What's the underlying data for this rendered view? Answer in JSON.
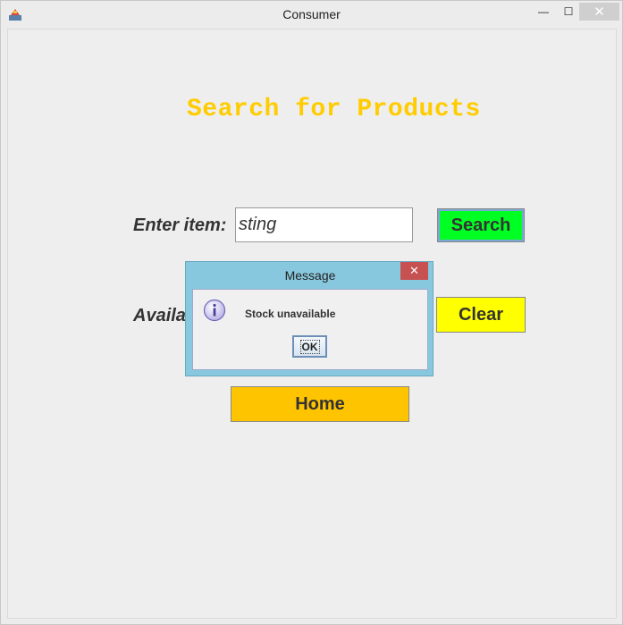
{
  "window": {
    "title": "Consumer",
    "minimize": "—",
    "maximize": "☐",
    "close": "✕"
  },
  "page": {
    "heading": "Search for Products"
  },
  "search": {
    "label": "Enter item:",
    "value": "sting",
    "button": "Search"
  },
  "availability": {
    "label_visible": "Availa"
  },
  "buttons": {
    "clear": "Clear",
    "home": "Home"
  },
  "dialog": {
    "title": "Message",
    "close": "✕",
    "message": "Stock unavailable",
    "ok": "OK"
  },
  "colors": {
    "heading": "#ffcc00",
    "search_button": "#00ff22",
    "clear_button": "#ffff00",
    "home_button": "#ffc400",
    "dialog_frame": "#88c8de",
    "dialog_close": "#c75050"
  }
}
